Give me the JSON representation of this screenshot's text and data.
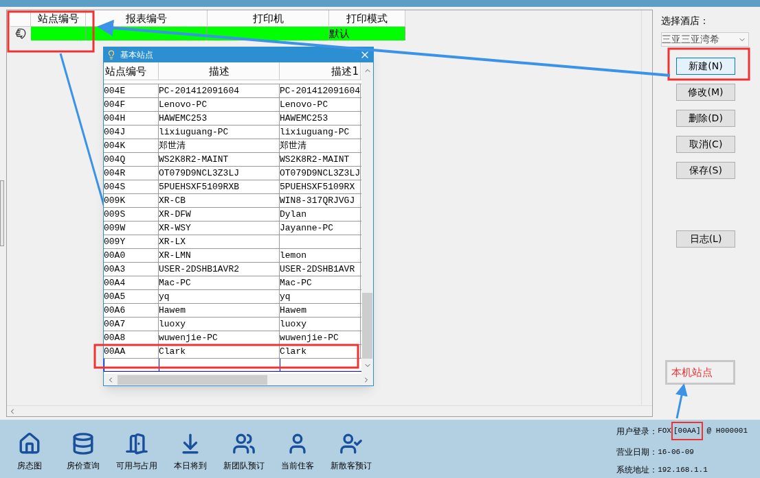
{
  "station_table": {
    "columns": [
      "站点编号",
      "报表编号",
      "打印机",
      "打印模式"
    ],
    "rows": [
      {
        "selected": true,
        "cells": [
          "",
          "",
          "",
          "默认"
        ]
      }
    ]
  },
  "dialog": {
    "title": "基本站点",
    "columns": [
      "站点编号",
      "描述",
      "描述1"
    ],
    "rows": [
      [
        "004E",
        "PC-201412091604",
        "PC-201412091604"
      ],
      [
        "004F",
        "Lenovo-PC",
        "Lenovo-PC"
      ],
      [
        "004H",
        "HAWEMC253",
        "HAWEMC253"
      ],
      [
        "004J",
        "lixiuguang-PC",
        "lixiuguang-PC"
      ],
      [
        "004K",
        "郑世清",
        "郑世清"
      ],
      [
        "004Q",
        "WS2K8R2-MAINT",
        "WS2K8R2-MAINT"
      ],
      [
        "004R",
        "OT079D9NCL3Z3LJ",
        "OT079D9NCL3Z3LJ"
      ],
      [
        "004S",
        "5PUEHSXF5109RXB",
        "5PUEHSXF5109RX"
      ],
      [
        "009K",
        "XR-CB",
        "WIN8-317QRJVGJ"
      ],
      [
        "009S",
        "XR-DFW",
        "Dylan"
      ],
      [
        "009W",
        "XR-WSY",
        "Jayanne-PC"
      ],
      [
        "009Y",
        "XR-LX",
        ""
      ],
      [
        "00A0",
        "XR-LMN",
        "lemon"
      ],
      [
        "00A3",
        "USER-2DSHB1AVR2",
        "USER-2DSHB1AVR"
      ],
      [
        "00A4",
        "Mac-PC",
        "Mac-PC"
      ],
      [
        "00A5",
        "yq",
        "yq"
      ],
      [
        "00A6",
        "Hawem",
        "Hawem"
      ],
      [
        "00A7",
        "luoxy",
        "luoxy"
      ],
      [
        "00A8",
        "wuwenjie-PC",
        "wuwenjie-PC"
      ],
      [
        "00AA",
        "Clark",
        "Clark"
      ]
    ]
  },
  "hotel": {
    "label": "选择酒店：",
    "value": "三亚三亚湾希"
  },
  "buttons": [
    {
      "label": "新建(N)",
      "focused": true
    },
    {
      "label": "修改(M)",
      "focused": false
    },
    {
      "label": "删除(D)",
      "focused": false
    },
    {
      "label": "取消(C)",
      "focused": false
    },
    {
      "label": "保存(S)",
      "focused": false
    },
    {
      "label": "日志(L)",
      "focused": false
    }
  ],
  "callout": "本机站点",
  "toolbar": [
    "房态图",
    "房价查询",
    "可用与占用",
    "本日将到",
    "新团队预订",
    "当前住客",
    "新散客预订"
  ],
  "status": [
    {
      "label": "用户登录：",
      "value": "FOX",
      "highlighted": "[00AA]",
      "rest": "@ H000001"
    },
    {
      "label": "营业日期：",
      "value": "16-06-09"
    },
    {
      "label": "系统地址：",
      "value": "192.168.1.1"
    }
  ]
}
